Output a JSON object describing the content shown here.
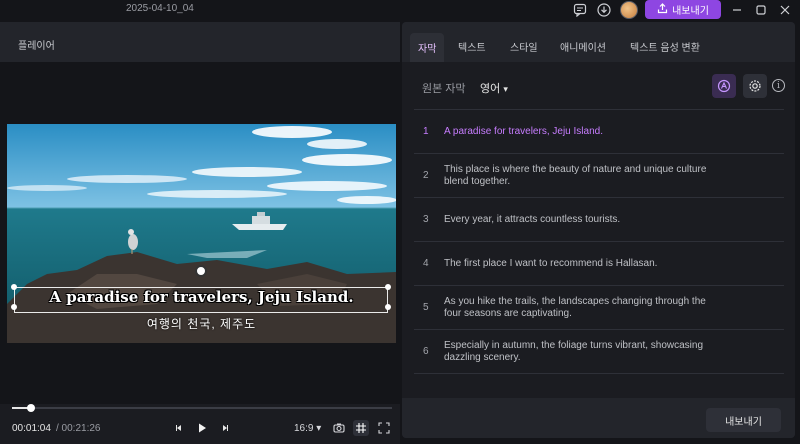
{
  "titlebar": {
    "title": "2025-04-10_04",
    "export_label": "내보내기",
    "icons": [
      "chat-icon",
      "download-icon",
      "avatar",
      "minimize-icon",
      "maximize-icon",
      "close-icon"
    ]
  },
  "player": {
    "header_label": "플레이어",
    "subtitle_en": "A paradise for travelers, Jeju Island.",
    "subtitle_ko": "여행의 천국, 제주도",
    "progress_fraction": 0.05,
    "current_time": "00:01:04",
    "total_time": "/ 00:21:26",
    "aspect_ratio": "16:9 ▾"
  },
  "panel": {
    "tabs": [
      {
        "label": "자막",
        "active": true
      },
      {
        "label": "텍스트",
        "active": false
      },
      {
        "label": "스타일",
        "active": false
      },
      {
        "label": "애니메이션",
        "active": false
      },
      {
        "label": "텍스트 음성 변환",
        "active": false
      }
    ],
    "source_label": "원본 자막",
    "language": "영어",
    "rows": [
      {
        "num": "1",
        "text": "A paradise for travelers, Jeju Island.",
        "active": true
      },
      {
        "num": "2",
        "text": "This place is where the beauty of nature and unique culture blend together.",
        "active": false
      },
      {
        "num": "3",
        "text": "Every year, it attracts countless tourists.",
        "active": false
      },
      {
        "num": "4",
        "text": "The first place I want to recommend is Hallasan.",
        "active": false
      },
      {
        "num": "5",
        "text": "As you hike the trails, the landscapes changing through the four seasons are captivating.",
        "active": false
      },
      {
        "num": "6",
        "text": "Especially in autumn, the foliage turns vibrant, showcasing dazzling scenery.",
        "active": false
      }
    ],
    "export_label": "내보내기"
  },
  "colors": {
    "accent": "#8e46e2",
    "active_text": "#c77dff",
    "panel_bg": "#1b1c21"
  }
}
